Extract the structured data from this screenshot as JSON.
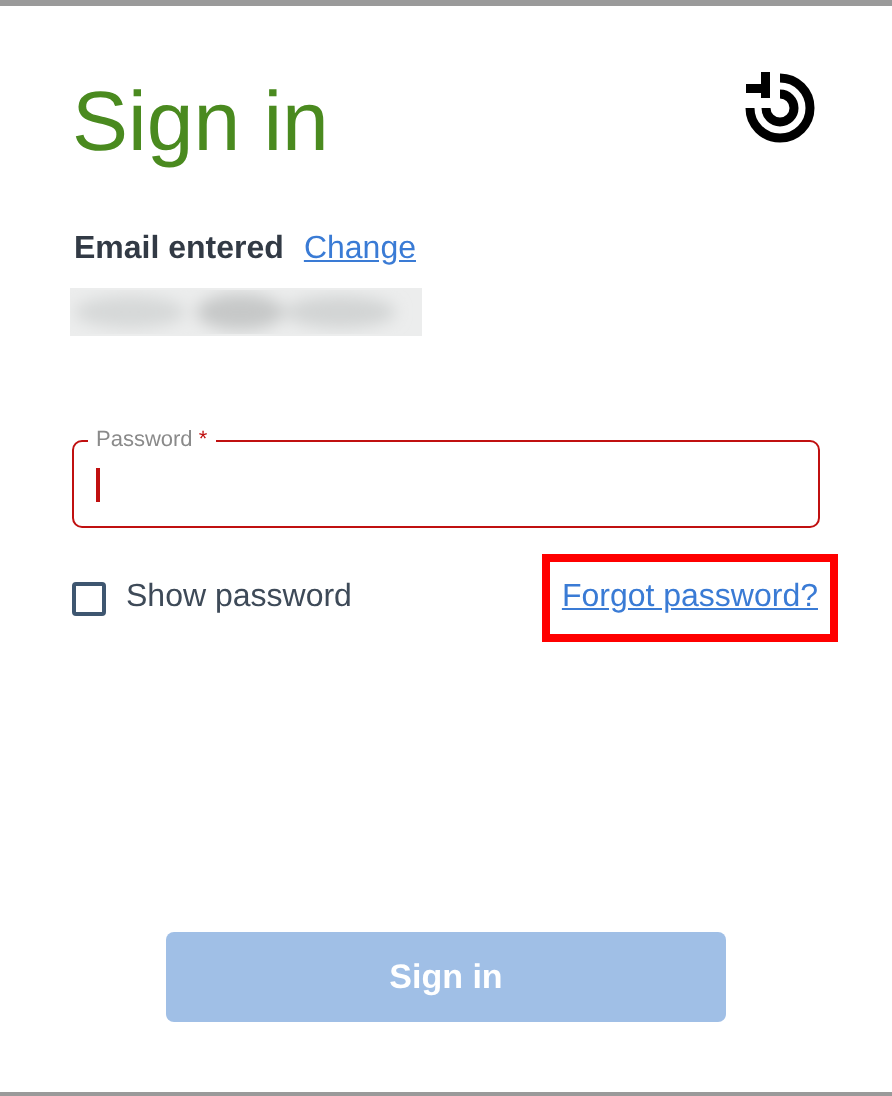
{
  "title": "Sign in",
  "email": {
    "label": "Email entered",
    "change_link": "Change",
    "value_hidden": true
  },
  "password": {
    "label": "Password",
    "required_mark": "*",
    "invalid": true
  },
  "show_password": {
    "label": "Show password",
    "checked": false
  },
  "forgot_link": {
    "label": "Forgot password?",
    "highlighted": true
  },
  "submit": {
    "label": "Sign in",
    "disabled": true
  }
}
